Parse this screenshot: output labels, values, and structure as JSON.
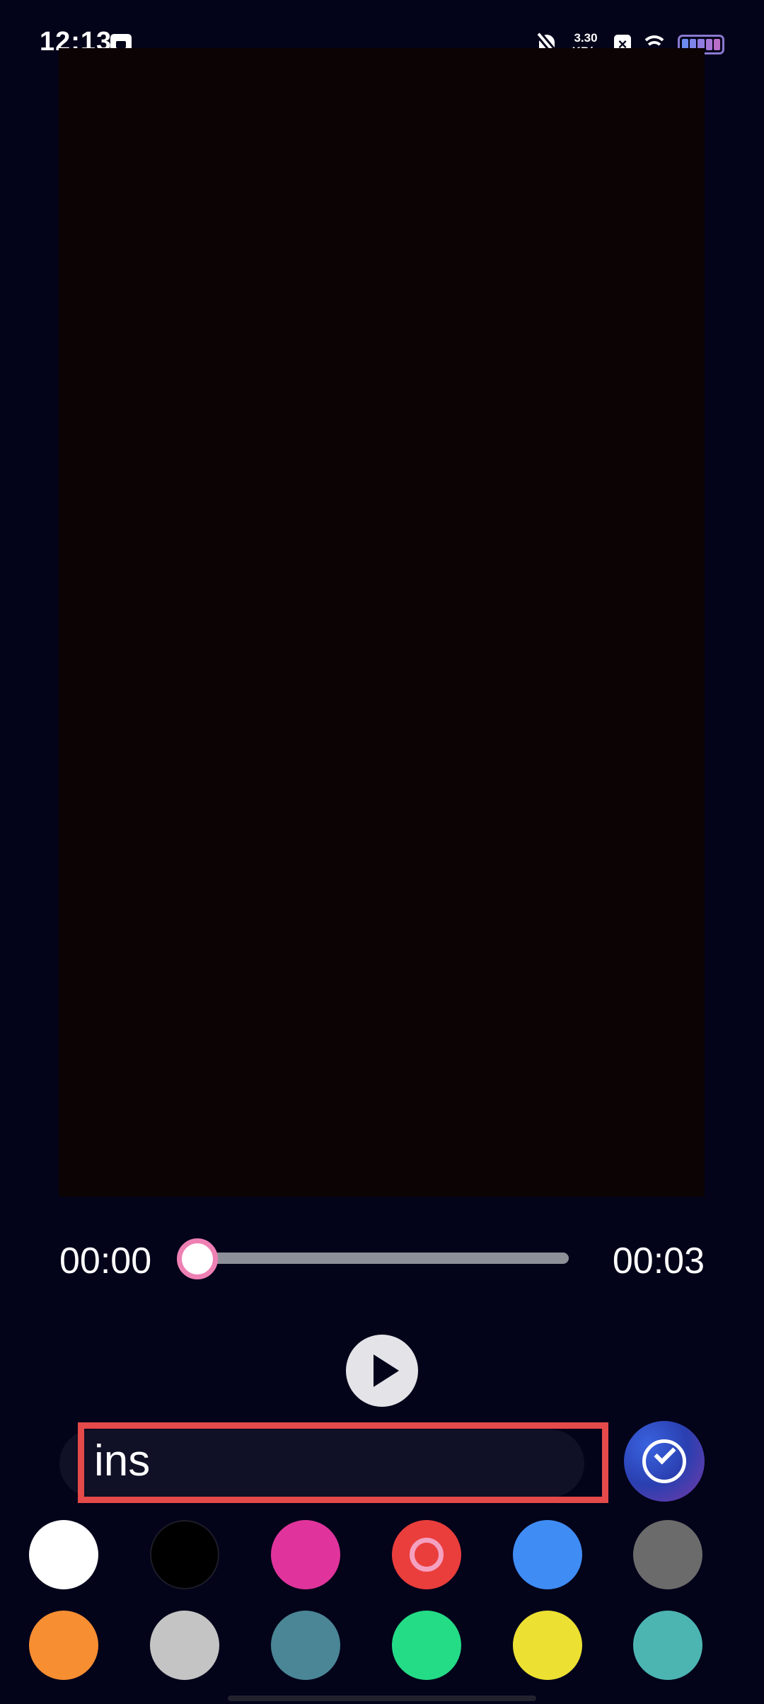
{
  "status_bar": {
    "time": "12:13",
    "network_speed_value": "3.30",
    "network_speed_unit": "KB/s",
    "icons": [
      "notification-icon",
      "bell-muted-icon",
      "close-box-icon",
      "wifi-icon",
      "battery-icon"
    ]
  },
  "player": {
    "current_time": "00:00",
    "total_time": "00:03",
    "progress": 0,
    "play_icon": "play-icon"
  },
  "text_input": {
    "value": "ins"
  },
  "confirm": {
    "icon": "check-circle-icon"
  },
  "colors": {
    "accent_highlight": "#e44a4a",
    "slider_thumb_border": "#ee80b4",
    "palette": [
      "#ffffff",
      "#000000",
      "#e0349c",
      "#ea3e3c",
      "#3f8cf4",
      "#6b6b6b",
      "#f78e32",
      "#c4c4c4",
      "#4a8696",
      "#24dc86",
      "#ece032",
      "#4cb5b2"
    ],
    "selected_index": 3
  }
}
